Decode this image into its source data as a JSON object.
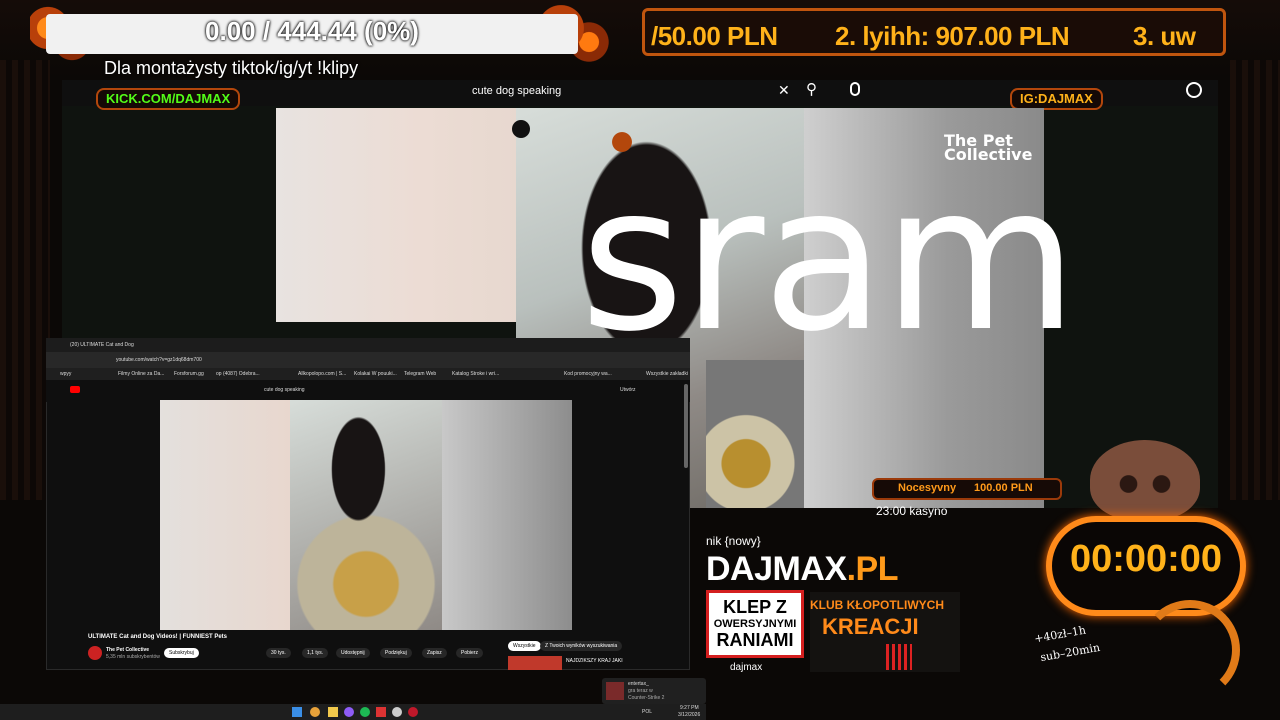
{
  "overlay": {
    "progress_text": "0.00 / 444.44 (0%)",
    "clips_text": "Dla montażysty tiktok/ig/yt !klipy",
    "ticker": [
      "/50.00 PLN",
      "2. lyihh: 907.00 PLN",
      "3. uw"
    ],
    "kick_tag": "KICK.COM/DAJMAX",
    "ig_tag": "IG:DAJMAX",
    "big_caption": "sram"
  },
  "main_browser": {
    "search_value": "cute dog speaking",
    "channel_logo": "The Pet Collective"
  },
  "embedded_browser": {
    "tab_title": "(20) ULTIMATE Cat and Dog",
    "url": "youtube.com/watch?v=gz1dq68dm700",
    "bookmarks": [
      "wpyy",
      "Filmy Online za Da...",
      "Forsforum.gg",
      "op (4087) Odebra...",
      "Allkopolopo.com | S...",
      "Kolakai W pouuki...",
      "Telegram Web",
      "Katalog Stroke i wri...",
      "Kod promocyjny wa...",
      "Wszystkie zakładki"
    ],
    "search_value": "cute dog speaking",
    "create_label": "Utwórz",
    "video_title": "ULTIMATE Cat and Dog Videos! | FUNNIEST Pets",
    "channel_name": "The Pet Collective",
    "subscribers": "5,35 mln subskrybentów",
    "subscribe_label": "Subskrybuj",
    "likes": "30 tys.",
    "dislikes": "1,1 tys.",
    "share_label": "Udostępnij",
    "thanks_label": "Podziękuj",
    "save_label": "Zapisz",
    "download_label": "Pobierz",
    "chip_all": "Wszystkie",
    "chip_search": "Z Twoich wyników wyszukiwania",
    "side_video_title": "NAJDZIKSZY KRAJ JAKI",
    "notification_name": "entertax_",
    "notification_line1": "gra teraz w",
    "notification_line2": "Counter-Strike 2",
    "tray_lang": "POL",
    "tray_time": "9:27 PM",
    "tray_date": "3/12/2026"
  },
  "widgets": {
    "donation_name": "Nocesyvny",
    "donation_amount": "100.00 PLN",
    "schedule": "23:00 kasyno",
    "chat_label": "nik {nowy}",
    "brand_left": "DAJMAX",
    "brand_right": ".PL",
    "promo_line1": "KLEP Z",
    "promo_line2": "OWERSYJNYMI",
    "promo_line3": "RANIAMI",
    "klub_line1": "KLUB KŁOPOTLIWYCH",
    "klub_line2": "KREACJI",
    "social_handle": "dajmax",
    "timer": "00:00:00",
    "bat_text": "+40zł–1h",
    "bat_text2": "sub–20min"
  }
}
